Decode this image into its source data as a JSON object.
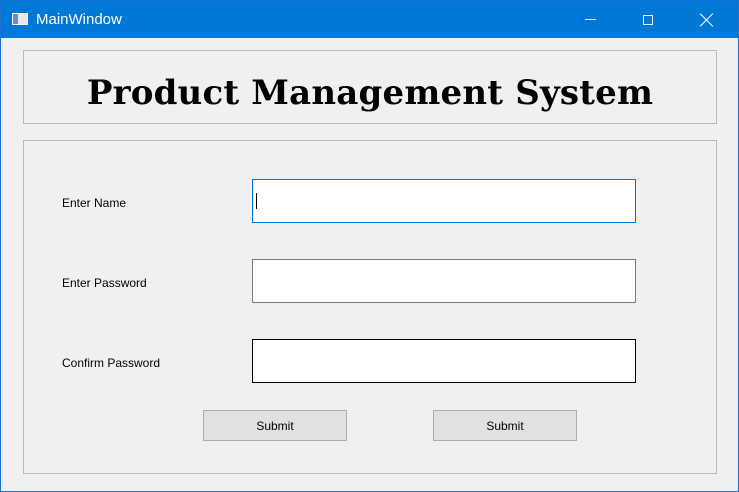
{
  "window": {
    "title": "MainWindow",
    "icon": "app-window-icon",
    "controls": [
      "minimize-icon",
      "maximize-icon",
      "close-icon"
    ]
  },
  "header": {
    "title": "Product Management System"
  },
  "form": {
    "fields": [
      {
        "label": "Enter Name",
        "value": "",
        "focused": true
      },
      {
        "label": "Enter Password",
        "value": ""
      },
      {
        "label": "Confirm Password",
        "value": ""
      }
    ],
    "buttons": [
      {
        "label": "Submit"
      },
      {
        "label": "Submit"
      }
    ]
  },
  "colors": {
    "titlebar": "#0078d7",
    "background": "#f0f0f0",
    "focus_border": "#0078d7"
  }
}
